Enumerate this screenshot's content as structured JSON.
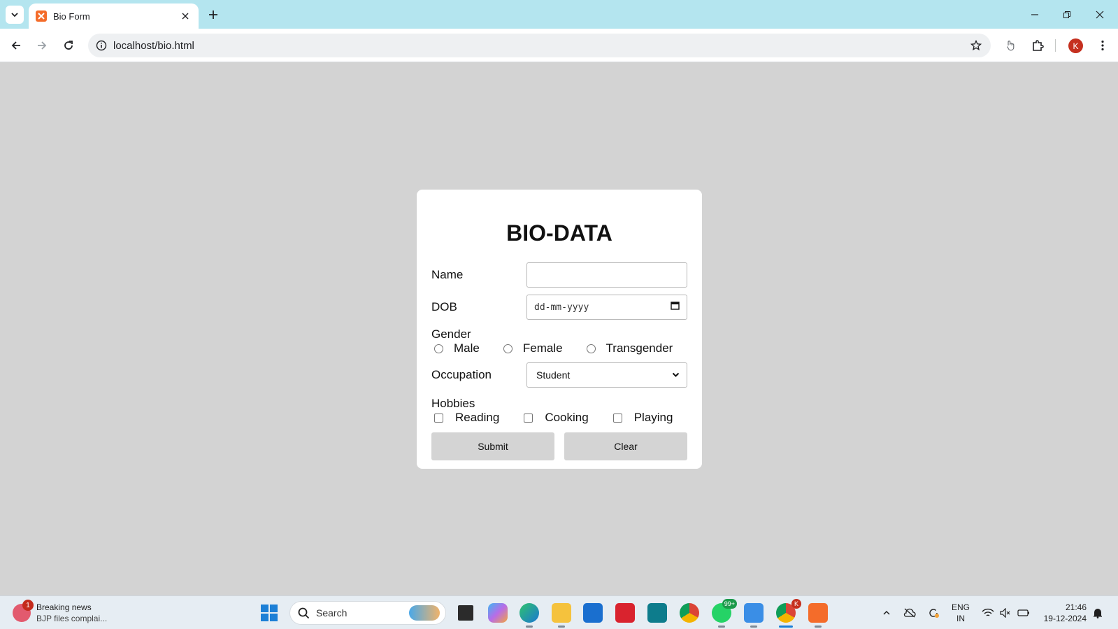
{
  "browser": {
    "tab_title": "Bio Form",
    "url": "localhost/bio.html",
    "profile_initial": "K"
  },
  "form": {
    "title": "BIO-DATA",
    "name_label": "Name",
    "name_value": "",
    "dob_label": "DOB",
    "dob_placeholder": "dd-mm-yyyy",
    "gender_label": "Gender",
    "gender_options": [
      "Male",
      "Female",
      "Transgender"
    ],
    "occupation_label": "Occupation",
    "occupation_selected": "Student",
    "hobbies_label": "Hobbies",
    "hobby_options": [
      "Reading",
      "Cooking",
      "Playing"
    ],
    "submit_label": "Submit",
    "clear_label": "Clear"
  },
  "taskbar": {
    "news_badge": "1",
    "news_title": "Breaking news",
    "news_subtitle": "BJP files complai...",
    "search_placeholder": "Search",
    "whatsapp_badge": "99+",
    "chrome_badge": "K",
    "lang_line1": "ENG",
    "lang_line2": "IN",
    "time": "21:46",
    "date": "19-12-2024"
  },
  "colors": {
    "page_background": "#d3d3d3",
    "tabbar": "#b4e5ef",
    "card": "#ffffff",
    "button": "#d4d4d4"
  }
}
